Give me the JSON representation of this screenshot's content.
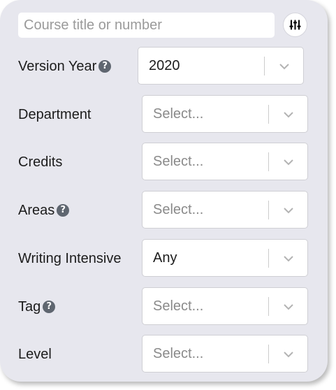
{
  "search": {
    "placeholder": "Course title or number",
    "value": ""
  },
  "filter_button": {
    "icon": "sliders-icon"
  },
  "filters": [
    {
      "key": "version_year",
      "label": "Version Year",
      "help": true,
      "value": "2020",
      "is_placeholder": false
    },
    {
      "key": "department",
      "label": "Department",
      "help": false,
      "value": "Select...",
      "is_placeholder": true
    },
    {
      "key": "credits",
      "label": "Credits",
      "help": false,
      "value": "Select...",
      "is_placeholder": true
    },
    {
      "key": "areas",
      "label": "Areas",
      "help": true,
      "value": "Select...",
      "is_placeholder": true
    },
    {
      "key": "writing_intensive",
      "label": "Writing Intensive",
      "help": false,
      "value": "Any",
      "is_placeholder": false
    },
    {
      "key": "tag",
      "label": "Tag",
      "help": true,
      "value": "Select...",
      "is_placeholder": true
    },
    {
      "key": "level",
      "label": "Level",
      "help": false,
      "value": "Select...",
      "is_placeholder": true
    }
  ],
  "help_glyph": "?",
  "colors": {
    "panel_bg": "#e7e7ee",
    "help_icon": "#5f6670",
    "placeholder_text": "#8a8a8a"
  }
}
